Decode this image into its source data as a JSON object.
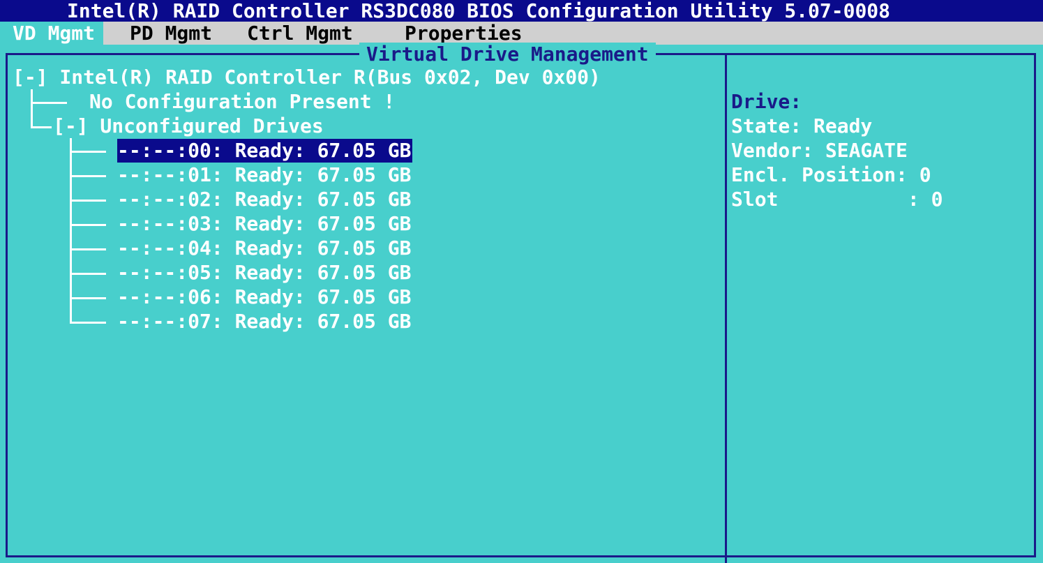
{
  "window": {
    "title": "Intel(R) RAID Controller RS3DC080 BIOS Configuration Utility 5.07-0008"
  },
  "tabs": [
    {
      "label": "VD Mgmt",
      "active": true
    },
    {
      "label": "PD Mgmt",
      "active": false
    },
    {
      "label": "Ctrl Mgmt",
      "active": false
    },
    {
      "label": "Properties",
      "active": false
    }
  ],
  "panel": {
    "title": "Virtual Drive Management"
  },
  "tree": {
    "controller": "[-] Intel(R) RAID Controller R(Bus 0x02, Dev 0x00)",
    "no_config": "No Configuration Present !",
    "unconfigured": "[-] Unconfigured Drives",
    "drives": [
      {
        "label": "--:--:00: Ready: 67.05 GB",
        "selected": true
      },
      {
        "label": "--:--:01: Ready: 67.05 GB",
        "selected": false
      },
      {
        "label": "--:--:02: Ready: 67.05 GB",
        "selected": false
      },
      {
        "label": "--:--:03: Ready: 67.05 GB",
        "selected": false
      },
      {
        "label": "--:--:04: Ready: 67.05 GB",
        "selected": false
      },
      {
        "label": "--:--:05: Ready: 67.05 GB",
        "selected": false
      },
      {
        "label": "--:--:06: Ready: 67.05 GB",
        "selected": false
      },
      {
        "label": "--:--:07: Ready: 67.05 GB",
        "selected": false
      }
    ]
  },
  "details": {
    "drive": "Drive:",
    "state": "State: Ready",
    "vendor": "Vendor: SEAGATE",
    "encl_position": "Encl. Position: 0",
    "slot": "Slot           : 0"
  },
  "colors": {
    "background": "#48cfcc",
    "title_bar": "#0a0a8c",
    "border": "#1a1a88",
    "menu_bar": "#d0d0d0",
    "text_white": "#ffffff"
  }
}
